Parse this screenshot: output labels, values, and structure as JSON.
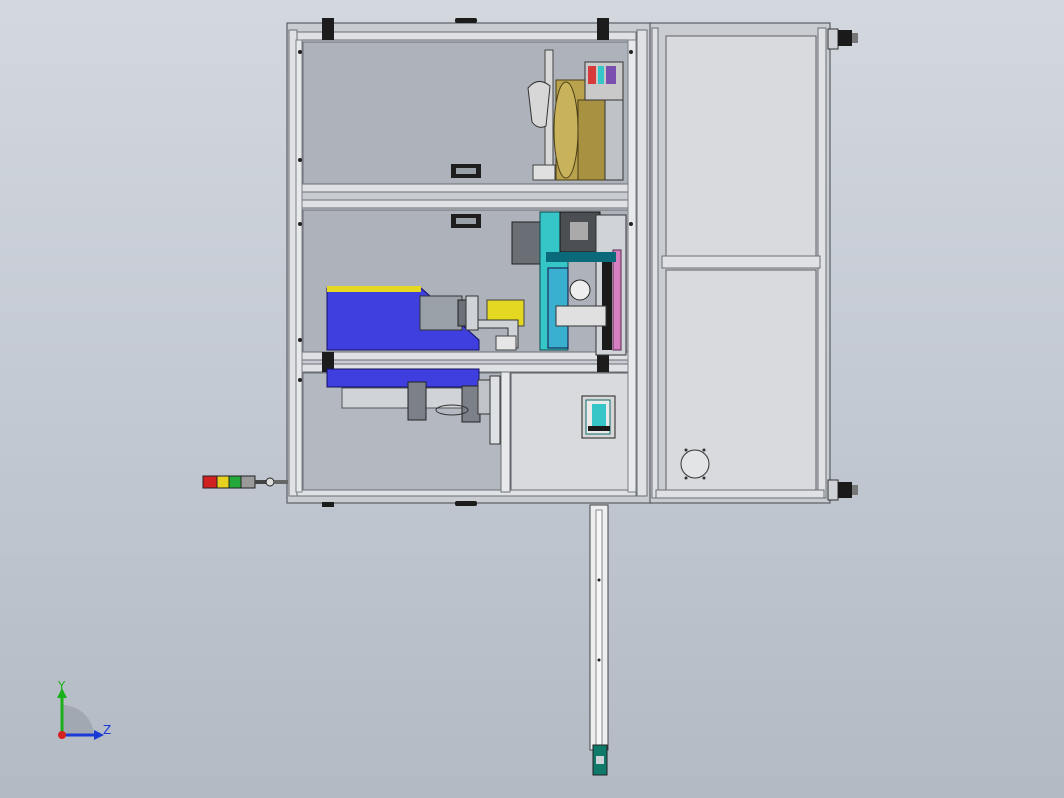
{
  "viewport": {
    "background_top": "#d3d8df",
    "background_bottom": "#b3bac4"
  },
  "triad": {
    "y_label": "Y",
    "z_label": "Z",
    "y_color": "#19b019",
    "z_color": "#1a3ad6",
    "origin_color": "#d62020"
  },
  "colors": {
    "frame": "#c9ccd1",
    "frame_edge": "#5a5f66",
    "panel": "#d9dadd",
    "cavity": "#aeb3bb",
    "blue_block": "#3f3fe0",
    "yellow": "#e5d822",
    "brass": "#b9a24d",
    "teal": "#36c6c8",
    "pink": "#d67fc1",
    "bracket": "#1c1c1c"
  },
  "signal_tower": {
    "segments": [
      "#d02020",
      "#e6d020",
      "#24a83a",
      "#9a9a9a"
    ]
  },
  "icons": {
    "top_handle": "handle-icon",
    "mid_handle": "handle-icon",
    "leveling_feet": "leveling-foot-icon",
    "vent_hole": "round-vent-icon"
  }
}
